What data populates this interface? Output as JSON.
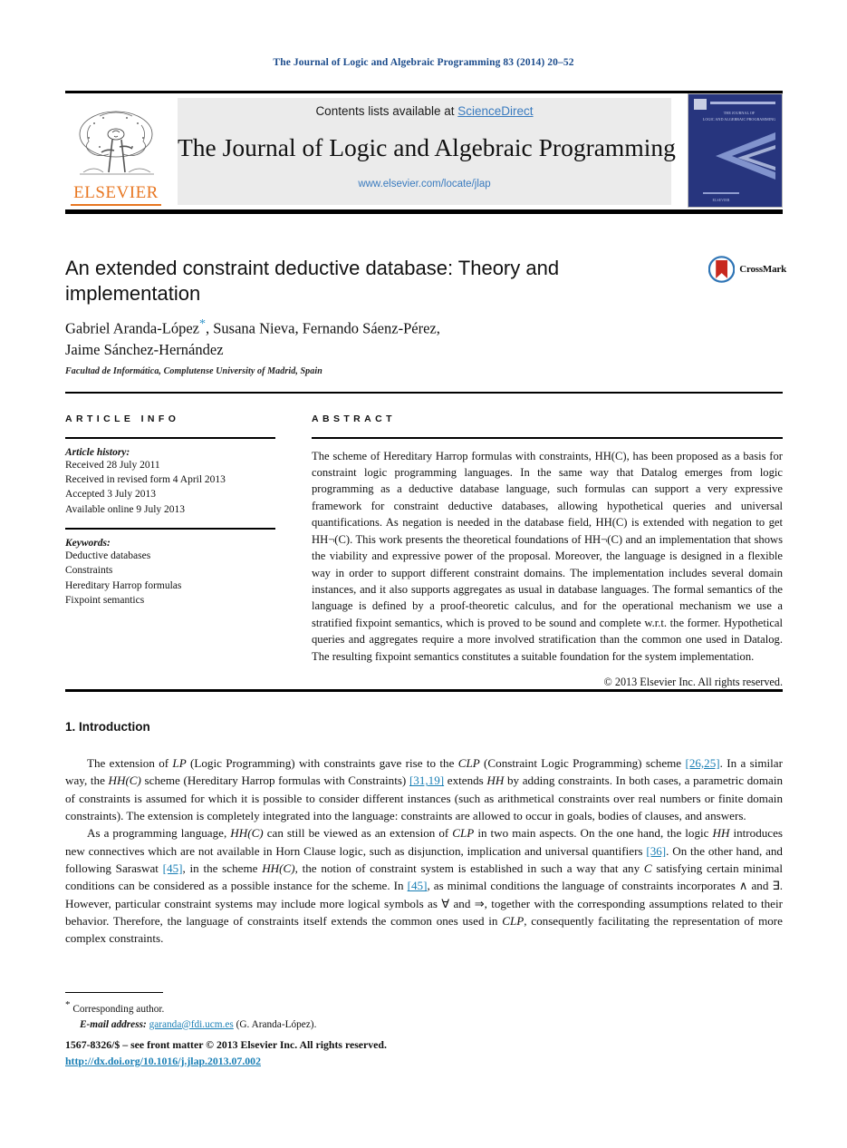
{
  "running_head": "The Journal of Logic and Algebraic Programming 83 (2014) 20–52",
  "masthead": {
    "publisher_name": "ELSEVIER",
    "contents_prefix": "Contents lists available at ",
    "contents_link": "ScienceDirect",
    "journal_title": "The Journal of Logic and Algebraic Programming",
    "journal_url": "www.elsevier.com/locate/jlap",
    "cover_title_line1": "THE JOURNAL OF",
    "cover_title_line2": "LOGIC AND ALGEBRAIC PROGRAMMING",
    "cover_footer": "ELSEVIER",
    "cover_color": "#27357e"
  },
  "article": {
    "title": "An extended constraint deductive database: Theory and implementation",
    "authors_line1": "Gabriel Aranda-López",
    "authors_star": "*",
    "authors_line1_rest": ", Susana Nieva, Fernando Sáenz-Pérez,",
    "authors_line2": "Jaime Sánchez-Hernández",
    "affiliation": "Facultad de Informática, Complutense University of Madrid, Spain",
    "crossmark_label": "CrossMark"
  },
  "info": {
    "heading": "ARTICLE INFO",
    "history_label": "Article history:",
    "history": [
      "Received 28 July 2011",
      "Received in revised form 4 April 2013",
      "Accepted 3 July 2013",
      "Available online 9 July 2013"
    ],
    "keywords_label": "Keywords:",
    "keywords": [
      "Deductive databases",
      "Constraints",
      "Hereditary Harrop formulas",
      "Fixpoint semantics"
    ]
  },
  "abstract": {
    "heading": "ABSTRACT",
    "text": "The scheme of Hereditary Harrop formulas with constraints, HH(C), has been proposed as a basis for constraint logic programming languages. In the same way that Datalog emerges from logic programming as a deductive database language, such formulas can support a very expressive framework for constraint deductive databases, allowing hypothetical queries and universal quantifications. As negation is needed in the database field, HH(C) is extended with negation to get HH¬(C). This work presents the theoretical foundations of HH¬(C) and an implementation that shows the viability and expressive power of the proposal. Moreover, the language is designed in a flexible way in order to support different constraint domains. The implementation includes several domain instances, and it also supports aggregates as usual in database languages. The formal semantics of the language is defined by a proof-theoretic calculus, and for the operational mechanism we use a stratified fixpoint semantics, which is proved to be sound and complete w.r.t. the former. Hypothetical queries and aggregates require a more involved stratification than the common one used in Datalog. The resulting fixpoint semantics constitutes a suitable foundation for the system implementation.",
    "copyright": "© 2013 Elsevier Inc. All rights reserved."
  },
  "body": {
    "section_number_title": "1. Introduction",
    "paragraph1_a": "The extension of ",
    "paragraph1_lp": "LP",
    "paragraph1_b": " (Logic Programming) with constraints gave rise to the ",
    "paragraph1_clp": "CLP",
    "paragraph1_c": " (Constraint Logic Programming) scheme ",
    "cite_2625": "[26,25]",
    "paragraph1_d": ". In a similar way, the ",
    "hhc_1": "HH(C)",
    "paragraph1_e": " scheme (Hereditary Harrop formulas with Constraints) ",
    "cite_3119": "[31,19]",
    "paragraph1_f": " extends ",
    "hh_1": "HH",
    "paragraph1_g": " by adding constraints. In both cases, a parametric domain of constraints is assumed for which it is possible to consider different instances (such as arithmetical constraints over real numbers or finite domain constraints). The extension is completely integrated into the language: constraints are allowed to occur in goals, bodies of clauses, and answers.",
    "paragraph2_a": "As a programming language, ",
    "hhc_2": "HH(C)",
    "paragraph2_b": " can still be viewed as an extension of ",
    "clp_2": "CLP",
    "paragraph2_c": " in two main aspects. On the one hand, the logic ",
    "hh_2": "HH",
    "paragraph2_d": " introduces new connectives which are not available in Horn Clause logic, such as disjunction, implication and universal quantifiers ",
    "cite_36": "[36]",
    "paragraph2_e": ". On the other hand, and following Saraswat ",
    "cite_45a": "[45]",
    "paragraph2_f": ", in the scheme ",
    "hhc_3": "HH(C)",
    "paragraph2_g": ", the notion of constraint system is established in such a way that any ",
    "c_1": "C",
    "paragraph2_h": " satisfying certain minimal conditions can be considered as a possible instance for the scheme. In ",
    "cite_45b": "[45]",
    "paragraph2_i": ", as minimal conditions the language of constraints incorporates ∧ and ∃. However, particular constraint systems may include more logical symbols as ∀ and ⇒, together with the corresponding assumptions related to their behavior. Therefore, the language of constraints itself extends the common ones used in ",
    "clp_3": "CLP",
    "paragraph2_j": ", consequently facilitating the representation of more complex constraints."
  },
  "footer": {
    "corresponding_marker": "*",
    "corresponding_text": "Corresponding author.",
    "email_label": "E-mail address:",
    "email": "garanda@fdi.ucm.es",
    "email_owner": "(G. Aranda-López).",
    "front_matter": "1567-8326/$ – see front matter © 2013 Elsevier Inc. All rights reserved.",
    "doi": "http://dx.doi.org/10.1016/j.jlap.2013.07.002"
  },
  "colors": {
    "link_blue": "#1a7fb5",
    "header_blue": "#1c4c8c",
    "sciencedirect_blue": "#3a7bbf",
    "elsevier_orange": "#E87722",
    "crossmark_red": "#c8281e",
    "crossmark_blue": "#2e74b5"
  }
}
